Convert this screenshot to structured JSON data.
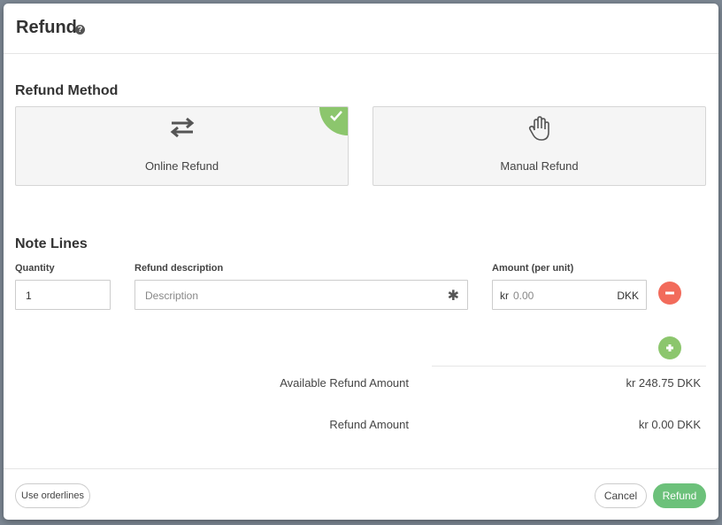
{
  "modal": {
    "title": "Refund"
  },
  "refund_method": {
    "heading": "Refund Method",
    "options": [
      {
        "label": "Online Refund",
        "icon": "transfer-arrows-icon",
        "selected": true
      },
      {
        "label": "Manual Refund",
        "icon": "hand-icon",
        "selected": false
      }
    ]
  },
  "note_lines": {
    "heading": "Note Lines",
    "columns": {
      "quantity": "Quantity",
      "description": "Refund description",
      "amount": "Amount (per unit)"
    },
    "line": {
      "quantity": "1",
      "description_placeholder": "Description",
      "currency_prefix": "kr",
      "amount_placeholder": "0.00",
      "currency_suffix": "DKK"
    }
  },
  "totals": {
    "available_label": "Available Refund Amount",
    "available_value": "kr 248.75 DKK",
    "refund_label": "Refund Amount",
    "refund_value": "kr 0.00 DKK"
  },
  "footer": {
    "use_orderlines": "Use orderlines",
    "cancel": "Cancel",
    "refund": "Refund"
  },
  "colors": {
    "selected_check": "#8cc66d",
    "remove_button": "#f26b5b",
    "add_button": "#8cc66d",
    "primary_button": "#6cc17a"
  }
}
